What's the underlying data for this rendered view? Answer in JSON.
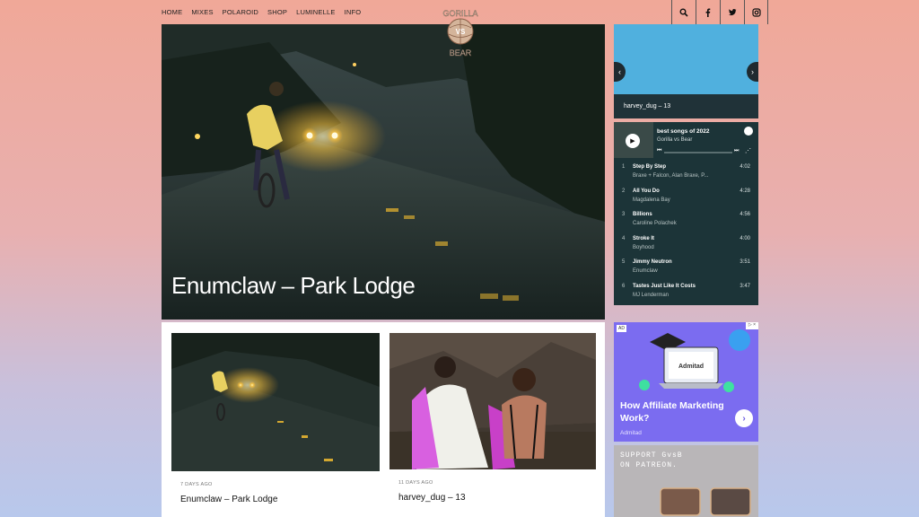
{
  "nav": {
    "items": [
      "HOME",
      "MIXES",
      "POLAROID",
      "SHOP",
      "LUMINELLE",
      "INFO"
    ],
    "logo_text": [
      "GORILLA",
      "VS",
      "BEAR"
    ]
  },
  "social": [
    "search-icon",
    "facebook-icon",
    "twitter-icon",
    "instagram-icon"
  ],
  "hero": {
    "title": "Enumclaw – Park Lodge"
  },
  "slider": {
    "caption": "harvey_dug – 13"
  },
  "spotify": {
    "playlist_title": "best songs of 2022",
    "owner": "Gorilla vs Bear",
    "tracks": [
      {
        "num": "1",
        "title": "Step By Step",
        "artist": "Braxe + Falcon, Alan Braxe, P...",
        "duration": "4:02"
      },
      {
        "num": "2",
        "title": "All You Do",
        "artist": "Magdalena Bay",
        "duration": "4:28"
      },
      {
        "num": "3",
        "title": "Billions",
        "artist": "Caroline Polachek",
        "duration": "4:56"
      },
      {
        "num": "4",
        "title": "Stroke It",
        "artist": "Boyhood",
        "duration": "4:00"
      },
      {
        "num": "5",
        "title": "Jimmy Neutron",
        "artist": "Enumclaw",
        "duration": "3:51"
      },
      {
        "num": "6",
        "title": "Tastes Just Like It Costs",
        "artist": "MJ Lenderman",
        "duration": "3:47"
      }
    ]
  },
  "ad": {
    "tag": "AD",
    "laptop_brand": "Admitad",
    "headline": "How Affiliate Marketing Work?",
    "brand": "Admitad"
  },
  "patreon": {
    "text": "SUPPORT GvsB ON PATREON."
  },
  "posts": [
    {
      "ago": "7 DAYS AGO",
      "title": "Enumclaw – Park Lodge"
    },
    {
      "ago": "11 DAYS AGO",
      "title": "harvey_dug – 13"
    }
  ],
  "colors": {
    "bg_top": "#f0a898",
    "bg_bottom": "#b8c8ec",
    "spotify_bg": "#1c3438",
    "ad_bg": "#7b6cf0"
  }
}
